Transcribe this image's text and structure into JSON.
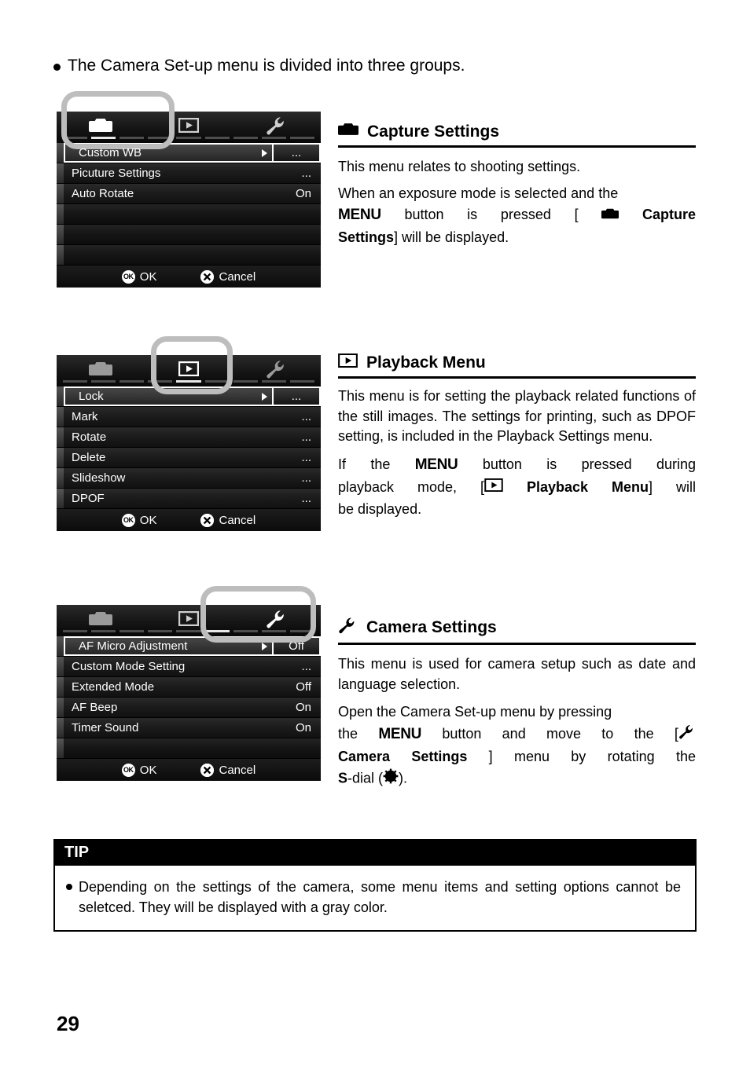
{
  "page": {
    "number": "29",
    "intro": "The Camera Set-up menu is divided into three groups."
  },
  "icons": {
    "camera": "camera-icon",
    "playback": "playback-icon",
    "wrench": "wrench-icon",
    "ok_badge": "OK",
    "cancel_badge": "cancel-x-icon",
    "s_dial": "s-dial-gear-icon"
  },
  "footer": {
    "ok_label": "OK",
    "cancel_label": "Cancel"
  },
  "sections": [
    {
      "id": "capture",
      "highlighted_tab": 0,
      "tabs": [
        "camera-icon",
        "playback-icon",
        "wrench-icon"
      ],
      "rows": [
        {
          "label": "Custom WB",
          "value": "...",
          "selected": true
        },
        {
          "label": "Picuture Settings",
          "value": "...",
          "selected": false
        },
        {
          "label": "Auto Rotate",
          "value": "On",
          "selected": false
        },
        {
          "label": "",
          "value": "",
          "selected": false
        },
        {
          "label": "",
          "value": "",
          "selected": false
        },
        {
          "label": "",
          "value": "",
          "selected": false
        }
      ],
      "heading": "Capture Settings",
      "heading_icon": "camera-icon",
      "paragraphs": [
        {
          "text": "This menu relates to shooting settings.",
          "justify": false
        },
        {
          "text": "When an exposure mode is selected and the MENU button is pressed [ Capture Settings] will be displayed.",
          "justify": true
        }
      ]
    },
    {
      "id": "playback",
      "highlighted_tab": 1,
      "tabs": [
        "camera-icon",
        "playback-icon",
        "wrench-icon"
      ],
      "rows": [
        {
          "label": "Lock",
          "value": "...",
          "selected": true
        },
        {
          "label": "Mark",
          "value": "...",
          "selected": false
        },
        {
          "label": "Rotate",
          "value": "...",
          "selected": false
        },
        {
          "label": "Delete",
          "value": "...",
          "selected": false
        },
        {
          "label": "Slideshow",
          "value": "...",
          "selected": false
        },
        {
          "label": "DPOF",
          "value": "...",
          "selected": false
        }
      ],
      "heading": "Playback Menu",
      "heading_icon": "playback-icon",
      "paragraphs": [
        {
          "text": "This menu is for setting the playback related functions of the still images. The settings for printing, such as DPOF setting, is included in the Playback Settings menu.",
          "justify": true
        },
        {
          "text": "If the MENU button is pressed during playback mode, [ Playback Menu] will be displayed.",
          "justify": true
        }
      ]
    },
    {
      "id": "camera-settings",
      "highlighted_tab": 2,
      "tabs": [
        "camera-icon",
        "playback-icon",
        "wrench-icon"
      ],
      "rows": [
        {
          "label": "AF Micro Adjustment",
          "value": "Off",
          "selected": true
        },
        {
          "label": "Custom Mode Setting",
          "value": "...",
          "selected": false
        },
        {
          "label": "Extended Mode",
          "value": "Off",
          "selected": false
        },
        {
          "label": "AF Beep",
          "value": "On",
          "selected": false
        },
        {
          "label": "Timer Sound",
          "value": "On",
          "selected": false
        },
        {
          "label": "",
          "value": "",
          "selected": false
        }
      ],
      "heading": "Camera Settings",
      "heading_icon": "wrench-icon",
      "paragraphs": [
        {
          "text": "This menu is used for camera setup such as date and language selection.",
          "justify": true
        },
        {
          "text": "Open the Camera Set-up menu by pressing the MENU button and move to the [ Camera Settings ] menu by rotating the S-dial ( ).",
          "justify": true
        }
      ]
    }
  ],
  "tip": {
    "title": "TIP",
    "body": "Depending on the settings of the camera, some menu items and setting options cannot be seletced.   They will be displayed with a gray color."
  },
  "text_fragments": {
    "capture_p1": "This menu relates to shooting settings.",
    "capture_p2_a": "When an exposure mode is selected and the",
    "capture_menu_kw": "MENU",
    "capture_p2_b": "button",
    "capture_p2_c": "is",
    "capture_p2_d": "pressed",
    "capture_p2_e": "[",
    "capture_p2_f": "Capture",
    "capture_p3_a": "Settings",
    "capture_p3_b": "] will be displayed.",
    "playback_p1": "This menu is for setting the playback related functions of the still images. The settings for printing, such as DPOF setting, is included in the Playback Settings menu.",
    "playback_p2_if": "If",
    "playback_p2_the": "the",
    "playback_p2_menu": "MENU",
    "playback_p2_rest": "button",
    "playback_p2_is": "is",
    "playback_p2_pressed": "pressed",
    "playback_p2_during": "during",
    "playback_p3_a": "playback",
    "playback_p3_b": "mode,",
    "playback_p3_c": "[",
    "playback_p3_d": "Playback",
    "playback_p3_e": "Menu",
    "playback_p3_f": "] will",
    "playback_p4": "be displayed.",
    "camera_p1": "This menu is used for camera setup such as date and language selection.",
    "camera_p2_a": "Open the Camera Set-up menu by pressing",
    "camera_p2_the": "the",
    "camera_p2_menu": "MENU",
    "camera_p2_button": "button",
    "camera_p2_and": "and",
    "camera_p2_move": "move",
    "camera_p2_to": "to",
    "camera_p2_the2": "the",
    "camera_p2_br": "[",
    "camera_p3_a": "Camera Settings",
    "camera_p3_b": "]",
    "camera_p3_c": "menu",
    "camera_p3_d": "by",
    "camera_p3_e": "rotating",
    "camera_p3_f": "the",
    "camera_p4_s": "S",
    "camera_p4_dial": "-dial (",
    "camera_p4_end": ")."
  }
}
